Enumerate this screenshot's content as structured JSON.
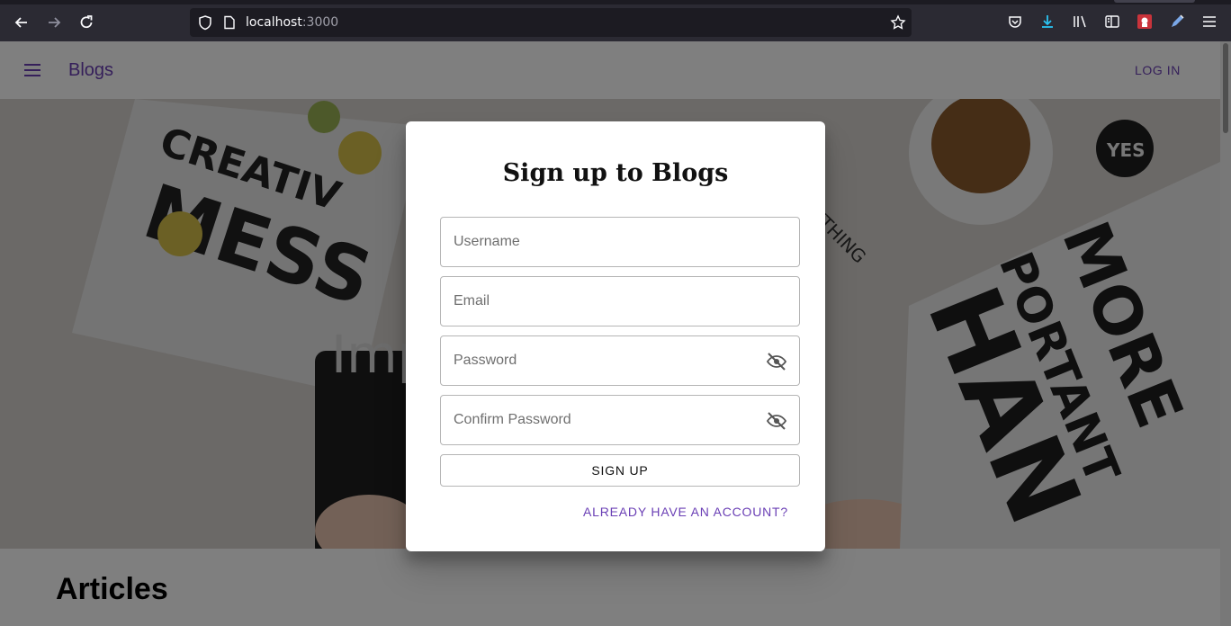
{
  "browser": {
    "url_host": "localhost",
    "url_port": ":3000",
    "icons": [
      "back-icon",
      "forward-icon",
      "reload-icon",
      "shield-icon",
      "page-icon",
      "bookmark-star-icon",
      "pocket-icon",
      "downloads-icon",
      "library-icon",
      "sidebar-icon",
      "extension-icon",
      "pen-icon",
      "menu-icon"
    ]
  },
  "appbar": {
    "brand": "Blogs",
    "login_label": "LOG IN",
    "accent_color": "#6a3fb5"
  },
  "hero": {
    "visible_text": "Imp                                    rd."
  },
  "articles": {
    "title": "Articles"
  },
  "dialog": {
    "title": "Sign up to Blogs",
    "fields": {
      "username_placeholder": "Username",
      "email_placeholder": "Email",
      "password_placeholder": "Password",
      "confirm_password_placeholder": "Confirm Password"
    },
    "signup_label": "SIGN UP",
    "have_account_label": "ALREADY HAVE AN ACCOUNT?"
  }
}
